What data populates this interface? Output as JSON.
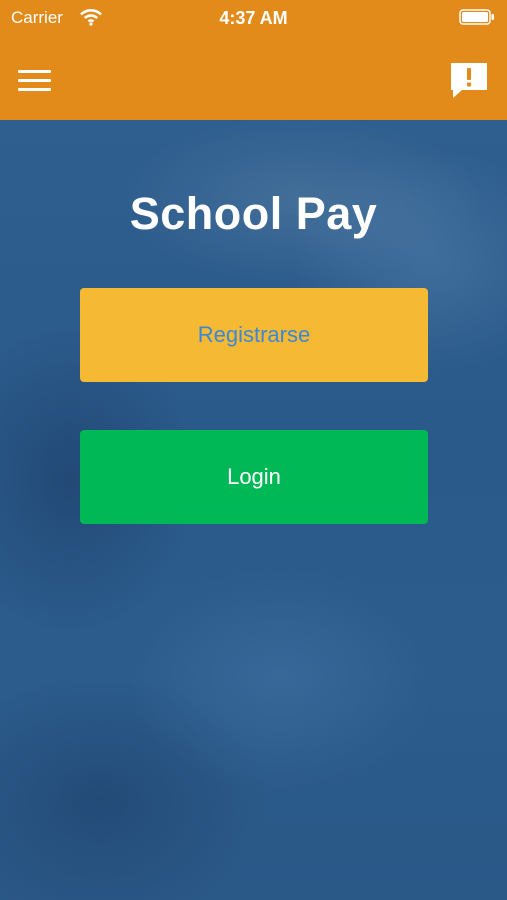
{
  "status_bar": {
    "carrier": "Carrier",
    "time": "4:37 AM",
    "wifi_icon": "wifi-icon",
    "battery_icon": "battery-icon"
  },
  "nav_bar": {
    "menu_icon": "hamburger-menu-icon",
    "alert_icon": "alert-speech-bubble-icon",
    "color": "#e28b1b"
  },
  "main": {
    "title": "School Pay",
    "register_label": "Registrarse",
    "login_label": "Login"
  },
  "colors": {
    "header": "#e28b1b",
    "register_button": "#f6b934",
    "register_text": "#3b89d6",
    "login_button": "#00b956",
    "login_text": "#ffffff",
    "background": "#2b5c8c"
  }
}
